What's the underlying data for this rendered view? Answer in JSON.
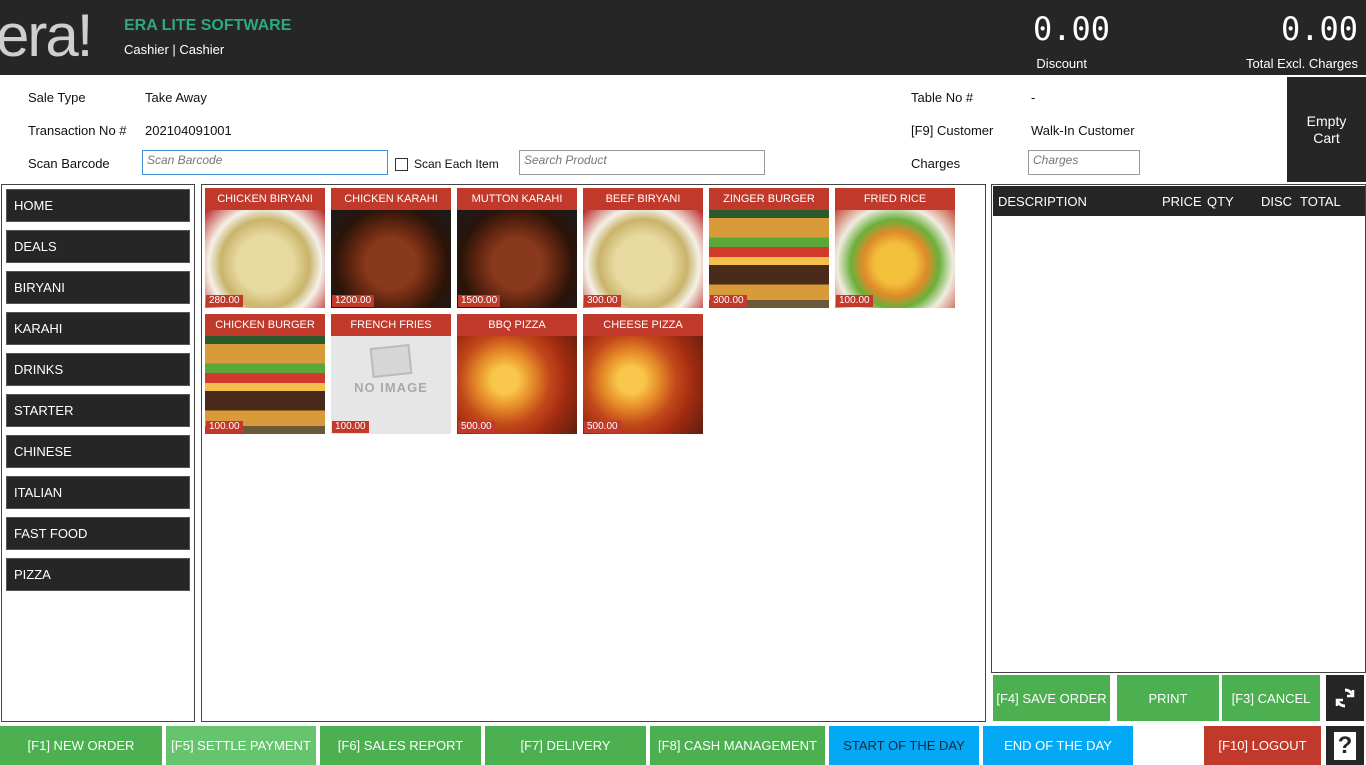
{
  "header": {
    "logo": "era!",
    "app_name": "ERA LITE SOFTWARE",
    "user": "Cashier | Cashier",
    "discount_value": "0.00",
    "discount_label": "Discount",
    "total_value": "0.00",
    "total_label": "Total Excl. Charges"
  },
  "info": {
    "sale_type_label": "Sale Type",
    "sale_type_value": "Take Away",
    "transaction_label": "Transaction No #",
    "transaction_value": "202104091001",
    "scan_barcode_label": "Scan Barcode",
    "scan_barcode_placeholder": "Scan Barcode",
    "scan_each_label": "Scan Each Item",
    "search_placeholder": "Search Product",
    "table_label": "Table No #",
    "table_value": "-",
    "customer_label": "[F9] Customer",
    "customer_value": "Walk-In Customer",
    "charges_label": "Charges",
    "charges_placeholder": "Charges",
    "empty_cart": "Empty Cart"
  },
  "categories": [
    "HOME",
    "DEALS",
    "BIRYANI",
    "KARAHI",
    "DRINKS",
    "STARTER",
    "CHINESE",
    "ITALIAN",
    "FAST FOOD",
    "PIZZA"
  ],
  "products": [
    {
      "name": "CHICKEN BIRYANI",
      "price": "280.00",
      "img": "biryani-image"
    },
    {
      "name": "CHICKEN KARAHI",
      "price": "1200.00",
      "img": "karahi-image"
    },
    {
      "name": "MUTTON KARAHI",
      "price": "1500.00",
      "img": "karahi-image"
    },
    {
      "name": "BEEF BIRYANI",
      "price": "300.00",
      "img": "biryani-image"
    },
    {
      "name": "ZINGER BURGER",
      "price": "300.00",
      "img": "burger-image"
    },
    {
      "name": "FRIED RICE",
      "price": "100.00",
      "img": "fried-rice-image"
    },
    {
      "name": "CHICKEN BURGER",
      "price": "100.00",
      "img": "burger-image"
    },
    {
      "name": "FRENCH FRIES",
      "price": "100.00",
      "img": "no-image",
      "no_image_text": "NO IMAGE"
    },
    {
      "name": "BBQ PIZZA",
      "price": "500.00",
      "img": "pizza-image"
    },
    {
      "name": "CHEESE PIZZA",
      "price": "500.00",
      "img": "pizza-image"
    }
  ],
  "cart": {
    "columns": [
      "DESCRIPTION",
      "PRICE",
      "QTY",
      "DISC",
      "TOTAL"
    ]
  },
  "actions": {
    "save_order": "[F4] SAVE ORDER",
    "print": "PRINT",
    "cancel": "[F3] CANCEL"
  },
  "footer": {
    "new_order": "[F1] NEW ORDER",
    "settle_payment": "[F5] SETTLE PAYMENT",
    "sales_report": "[F6] SALES REPORT",
    "delivery": "[F7] DELIVERY",
    "cash_management": "[F8] CASH MANAGEMENT",
    "start_day": "START OF THE DAY",
    "end_day": "END OF THE DAY",
    "logout": "[F10] LOGOUT",
    "help": "?"
  },
  "colors": {
    "header_bg": "#262626",
    "accent_green": "#2ea783",
    "button_green": "#4caf50",
    "button_blue": "#03a9f4",
    "product_red": "#c0392b",
    "logout_red": "#c0392b"
  }
}
